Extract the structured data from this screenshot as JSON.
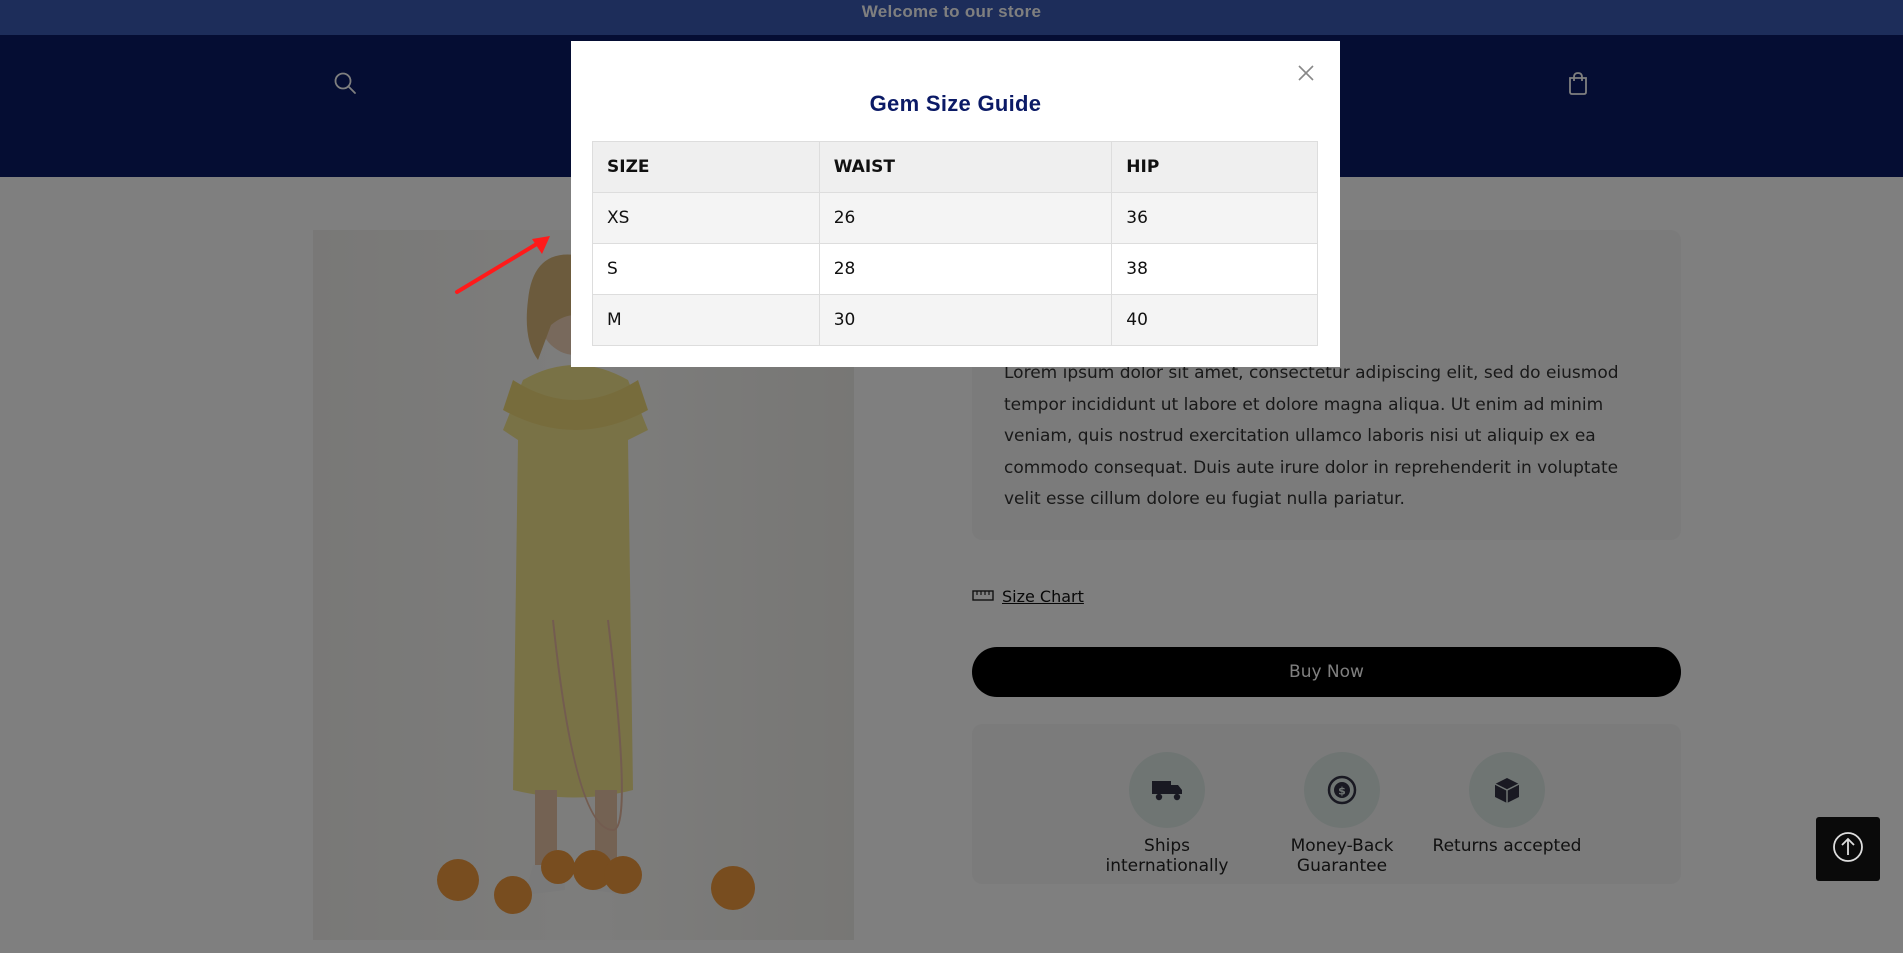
{
  "announcement": "Welcome to our store",
  "colors": {
    "announcement_bg": "#3b5bb5",
    "header_bg": "#0b1a66",
    "modal_title": "#0b1a66",
    "buy_button_bg": "#000000",
    "arrow": "#ff0000"
  },
  "header": {
    "icons": [
      "search-icon",
      "cart-icon"
    ]
  },
  "product": {
    "description": "Lorem ipsum dolor sit amet, consectetur adipiscing elit, sed do eiusmod tempor incididunt ut labore et dolore magna aliqua. Ut enim ad minim veniam, quis nostrud exercitation ullamco laboris nisi ut aliquip ex ea commodo consequat. Duis aute irure dolor in reprehenderit in voluptate velit esse cillum dolore eu fugiat nulla pariatur.",
    "size_chart_label": "Size Chart",
    "buy_label": "Buy Now",
    "features": [
      {
        "label": "Ships internationally",
        "icon": "truck-icon"
      },
      {
        "label": "Money-Back Guarantee",
        "icon": "money-back-icon"
      },
      {
        "label": "Returns accepted",
        "icon": "box-icon"
      }
    ]
  },
  "modal": {
    "title": "Gem Size Guide",
    "columns": [
      "SIZE",
      "WAIST",
      "HIP"
    ],
    "rows": [
      [
        "XS",
        "26",
        "36"
      ],
      [
        "S",
        "28",
        "38"
      ],
      [
        "M",
        "30",
        "40"
      ]
    ]
  }
}
